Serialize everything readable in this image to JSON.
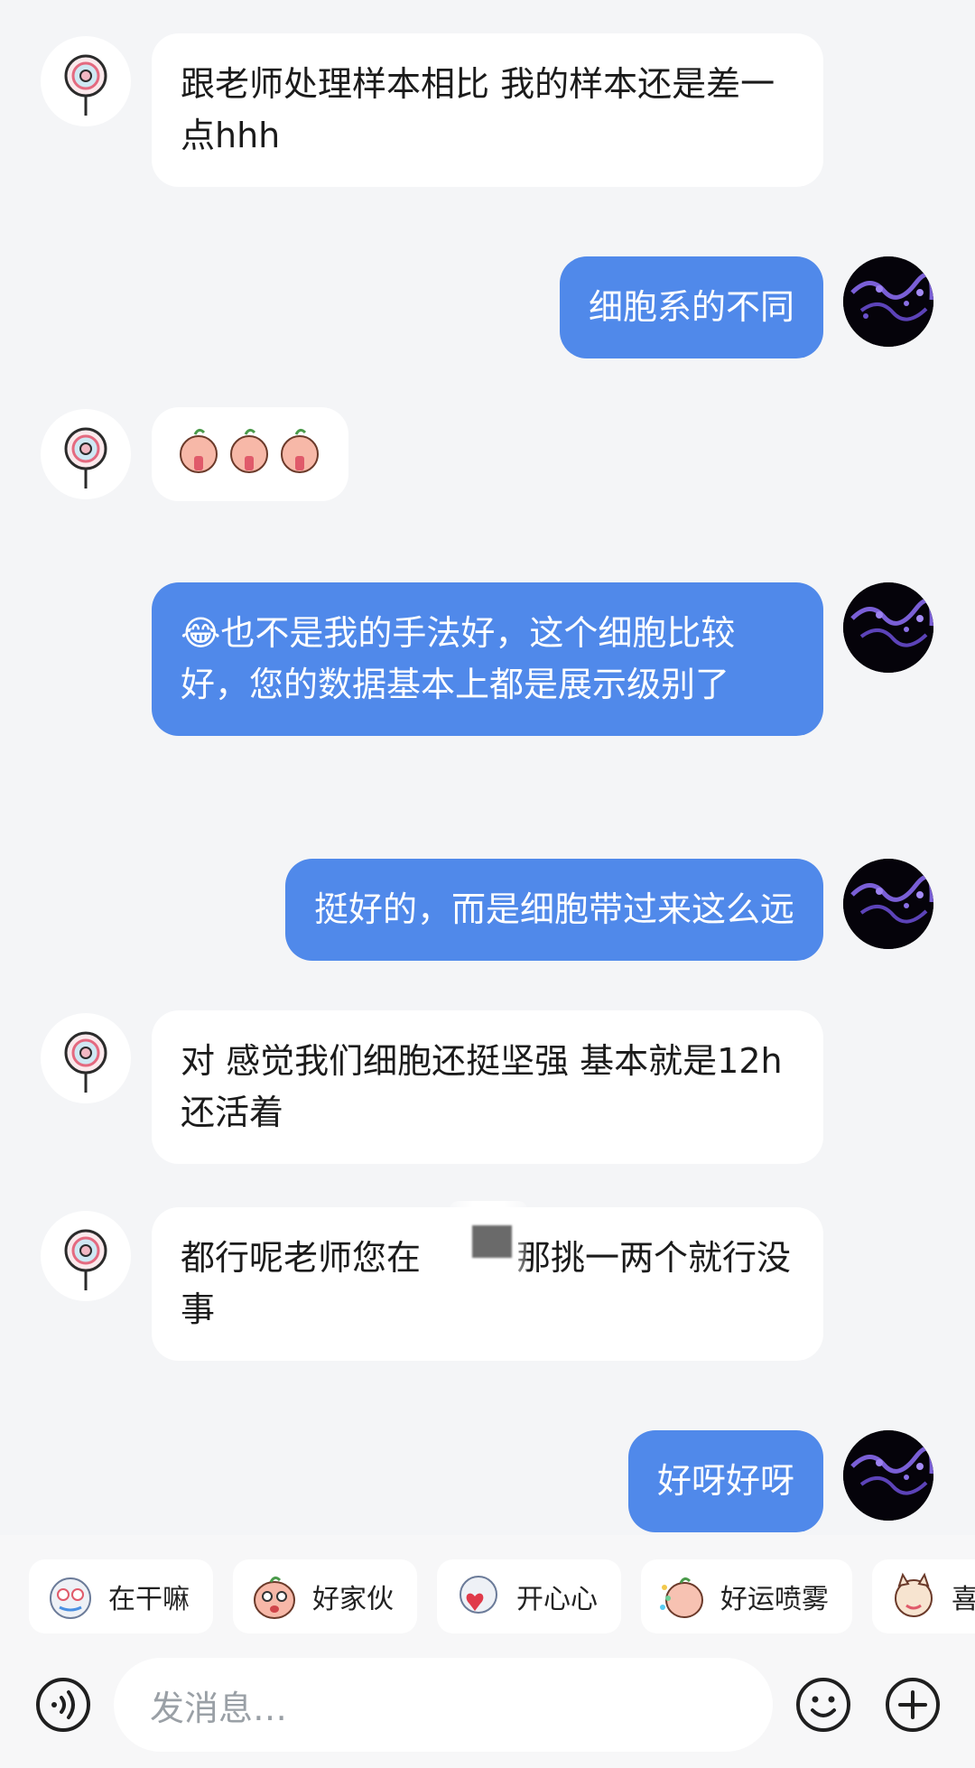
{
  "messages": [
    {
      "id": "m1",
      "sender": "teacher",
      "text": "跟老师处理样本相比 我的样本还是差一点hhh"
    },
    {
      "id": "m2",
      "sender": "self",
      "text": "细胞系的不同"
    },
    {
      "id": "m3",
      "sender": "teacher",
      "text": "",
      "stickers": [
        "peach-pray-emoji",
        "peach-pray-emoji",
        "peach-pray-emoji"
      ]
    },
    {
      "id": "m4",
      "sender": "self",
      "emoji": "😂",
      "text": "也不是我的手法好，这个细胞比较好，您的数据基本上都是展示级别了"
    },
    {
      "id": "m5",
      "sender": "self",
      "text": "挺好的，而是细胞带过来这么远"
    },
    {
      "id": "m6",
      "sender": "teacher",
      "text": "对 感觉我们细胞还挺坚强 基本就是12h 还活着"
    },
    {
      "id": "m7",
      "sender": "teacher",
      "text_before": "都行呢老师您在",
      "text_after": "那挑一两个就行没事"
    },
    {
      "id": "m8",
      "sender": "self",
      "text": "好呀好呀"
    }
  ],
  "quick_stickers": [
    {
      "label": "在干嘛",
      "icon": "crying-sticker-icon"
    },
    {
      "label": "好家伙",
      "icon": "peach-shocked-sticker-icon"
    },
    {
      "label": "开心心",
      "icon": "heart-hug-sticker-icon"
    },
    {
      "label": "好运喷雾",
      "icon": "lucky-spray-sticker-icon"
    },
    {
      "label": "喜",
      "icon": "cat-sticker-icon"
    }
  ],
  "composer": {
    "placeholder": "发消息…",
    "voice_icon": "voice-icon",
    "emoji_icon": "emoji-icon",
    "plus_icon": "plus-icon"
  },
  "colors": {
    "outgoing_bubble": "#5089ea",
    "incoming_bubble": "#ffffff",
    "background": "#f4f5f7"
  }
}
